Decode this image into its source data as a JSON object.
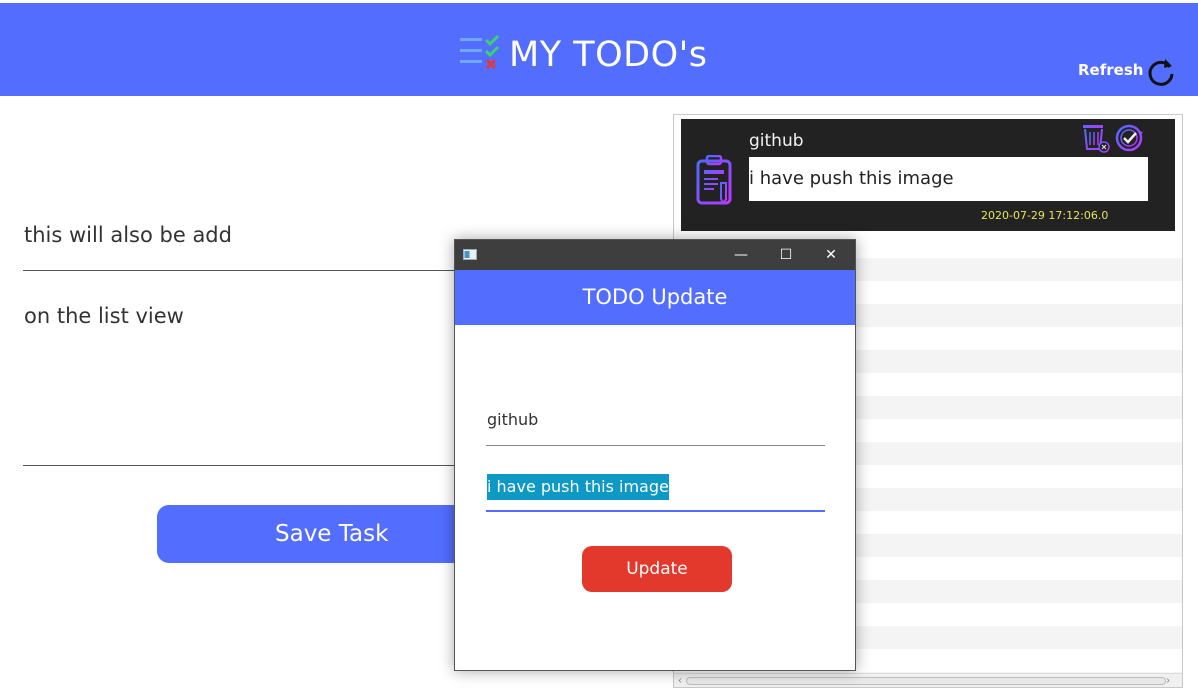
{
  "header": {
    "app_title": "MY TODO's",
    "refresh_label": "Refresh",
    "logo_icon": "checklist-icon",
    "refresh_icon": "refresh-icon",
    "background_color": "#536dfe"
  },
  "form": {
    "title_value": "this will also be add",
    "description_value": "on the list view",
    "save_label": "Save Task"
  },
  "list": {
    "items": [
      {
        "title": "github",
        "description": "i have push this image",
        "date": "2020-07-29 17:12:06.0",
        "icon": "clipboard-icon"
      }
    ]
  },
  "dialog": {
    "header_title": "TODO Update",
    "title_value": "github",
    "description_value": "i have push this image",
    "update_label": "Update",
    "minimize_glyph": "—",
    "maximize_glyph": "☐",
    "close_glyph": "✕",
    "update_color": "#e3392c"
  }
}
